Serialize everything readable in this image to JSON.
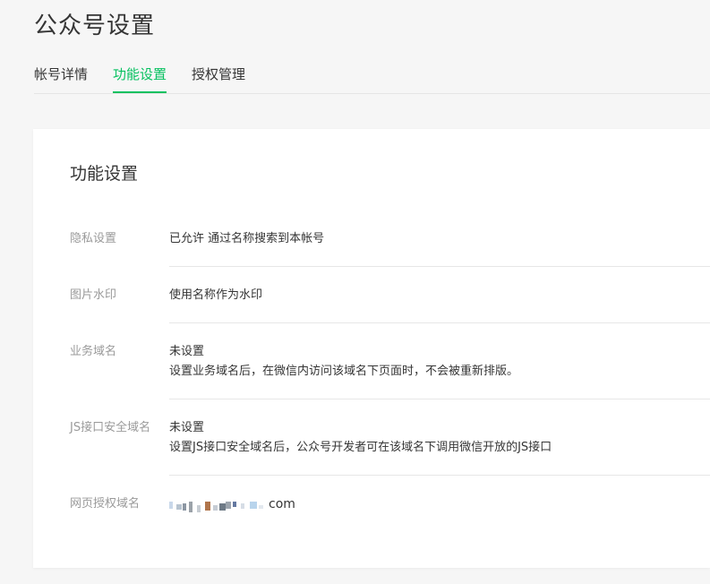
{
  "page": {
    "title": "公众号设置"
  },
  "tabs": [
    {
      "label": "帐号详情"
    },
    {
      "label": "功能设置"
    },
    {
      "label": "授权管理"
    }
  ],
  "active_tab": "功能设置",
  "card": {
    "title": "功能设置",
    "rows": [
      {
        "label": "隐私设置",
        "value": "已允许 通过名称搜索到本帐号"
      },
      {
        "label": "图片水印",
        "value": "使用名称作为水印"
      },
      {
        "label": "业务域名",
        "value": "未设置",
        "hint": "设置业务域名后，在微信内访问该域名下页面时，不会被重新排版。"
      },
      {
        "label": "JS接口安全域名",
        "value": "未设置",
        "hint": "设置JS接口安全域名后，公众号开发者可在该域名下调用微信开放的JS接口"
      },
      {
        "label": "网页授权域名",
        "value_suffix": "com"
      }
    ]
  },
  "colors": {
    "accent": "#07c160",
    "label": "#9a9a9a",
    "text": "#353535",
    "background": "#f6f6f6"
  }
}
